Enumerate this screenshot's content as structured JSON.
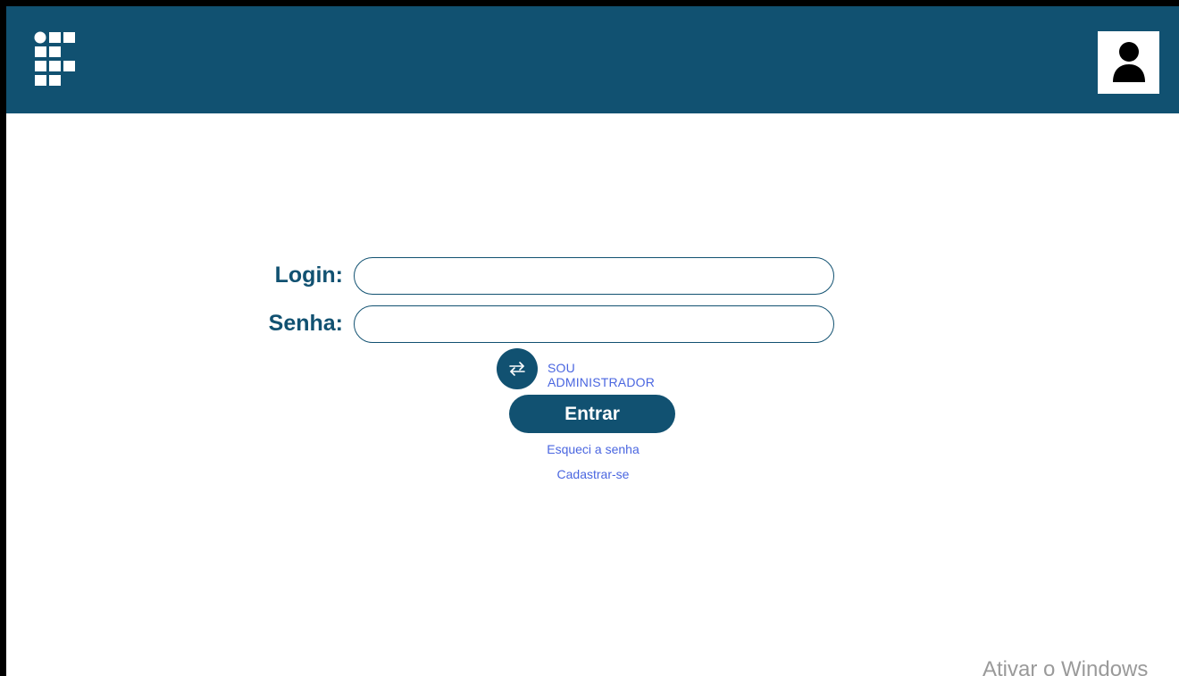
{
  "header": {
    "logo_icon": "institution-logo-icon",
    "avatar_icon": "user-icon",
    "color": "#115171"
  },
  "form": {
    "login_label": "Login:",
    "login_value": "",
    "password_label": "Senha:",
    "password_value": "",
    "admin_toggle_icon": "swap-arrows-icon",
    "admin_toggle_label": "SOU ADMINISTRADOR",
    "submit_label": "Entrar",
    "forgot_password": "Esqueci a senha",
    "register": "Cadastrar-se"
  },
  "system": {
    "watermark": "Ativar o Windows"
  },
  "colors": {
    "primary": "#115171",
    "link": "#4a66e0",
    "background": "#ffffff"
  }
}
